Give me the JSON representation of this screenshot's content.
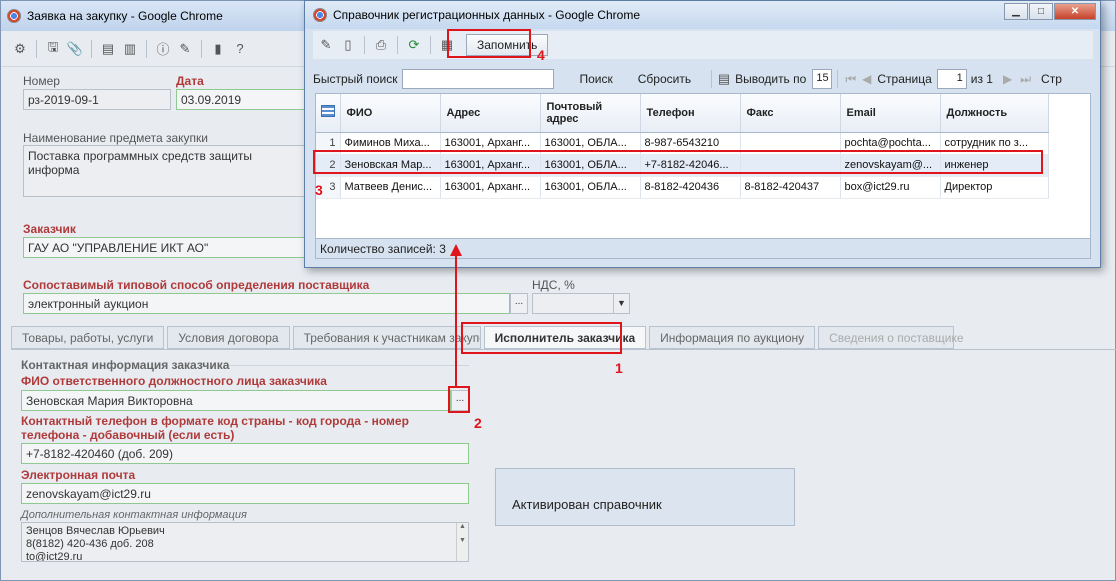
{
  "main": {
    "window_title": "Заявка на закупку - Google Chrome",
    "number_label": "Номер",
    "number_value": "рз-2019-09-1",
    "date_label": "Дата",
    "date_value": "03.09.2019",
    "subject_label": "Наименование предмета закупки",
    "subject_value": "Поставка программных средств защиты информа",
    "customer_label": "Заказчик",
    "customer_value": "ГАУ АО \"УПРАВЛЕНИЕ ИКТ АО\"",
    "method_label": "Сопоставимый типовой способ определения поставщика",
    "method_value": "электронный аукцион",
    "method_btn": "...",
    "vat_label": "НДС, %",
    "tabs": [
      "Товары, работы, услуги",
      "Условия договора",
      "Требования к участникам закупок",
      "Исполнитель заказчика",
      "Информация по аукциону",
      "Сведения о поставщике"
    ],
    "contact_section": "Контактная информация заказчика",
    "fio_label": "ФИО ответственного должностного лица заказчика",
    "fio_value": "Зеновская Мария Викторовна",
    "fio_btn": "...",
    "phone_label_1": "Контактный телефон в формате код страны - код города - номер",
    "phone_label_2": "телефона - добавочный (если есть)",
    "phone_value": "+7-8182-420460 (доб. 209)",
    "email_label": "Электронная почта",
    "email_value": "zenovskayam@ict29.ru",
    "extra_label": "Дополнительная контактная информация",
    "extra_line1": "Зенцов Вячеслав Юрьевич",
    "extra_line2": "8(8182) 420-436 доб. 208",
    "extra_line3": "to@ict29.ru",
    "notice": "Активирован справочник"
  },
  "popup": {
    "window_title": "Справочник регистрационных данных - Google Chrome",
    "remember_btn": "Запомнить",
    "quick_search_label": "Быстрый поиск",
    "search_btn": "Поиск",
    "reset_btn": "Сбросить",
    "show_by_label": "Выводить по",
    "show_by_value": "15",
    "page_label": "Страница",
    "page_value": "1",
    "page_of": "из 1",
    "page_tail": "Стр",
    "columns": [
      "ФИО",
      "Адрес",
      "Почтовый адрес",
      "Телефон",
      "Факс",
      "Email",
      "Должность"
    ],
    "rows": [
      {
        "n": "1",
        "fio": "Фиминов Миха...",
        "addr": "163001, Арханг...",
        "post": "163001, ОБЛА...",
        "phone": "8-987-6543210",
        "fax": "",
        "email": "pochta@pochta...",
        "pos": "сотрудник по з..."
      },
      {
        "n": "2",
        "fio": "Зеновская Мар...",
        "addr": "163001, Арханг...",
        "post": "163001, ОБЛА...",
        "phone": "+7-8182-42046...",
        "fax": "",
        "email": "zenovskayam@...",
        "pos": "инженер"
      },
      {
        "n": "3",
        "fio": "Матвеев Денис...",
        "addr": "163001, Арханг...",
        "post": "163001, ОБЛА...",
        "phone": "8-8182-420436",
        "fax": "8-8182-420437",
        "email": "box@ict29.ru",
        "pos": "Директор"
      }
    ],
    "records_count": "Количество записей: 3"
  },
  "annotations": {
    "n1": "1",
    "n2": "2",
    "n3": "3",
    "n4": "4",
    "color": "#e0141b"
  }
}
